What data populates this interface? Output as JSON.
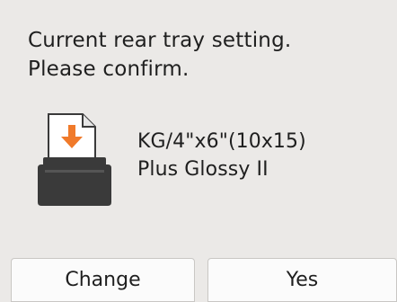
{
  "message": {
    "line1": "Current rear tray setting.",
    "line2": "Please confirm."
  },
  "media": {
    "size": "KG/4\"x6\"(10x15)",
    "type": "Plus Glossy II"
  },
  "icon": {
    "name": "printer-paper-icon",
    "arrow_color": "#f07a2a",
    "printer_color": "#3a3a3a"
  },
  "buttons": {
    "change_label": "Change",
    "yes_label": "Yes"
  }
}
